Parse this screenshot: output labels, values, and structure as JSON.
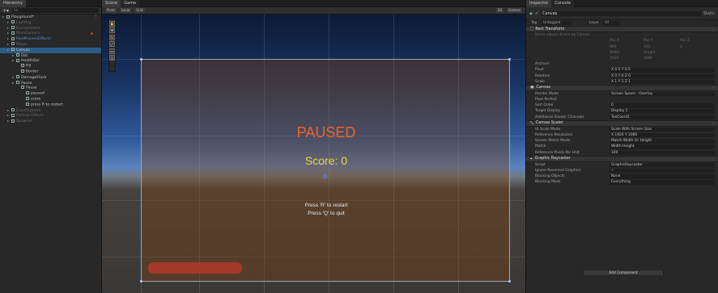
{
  "hierarchy": {
    "tab": "Hierarchy",
    "search_placeholder": "All",
    "items": [
      {
        "label": "Playground*",
        "depth": 0,
        "style": "scene"
      },
      {
        "label": "Lighting",
        "depth": 1,
        "style": "dim"
      },
      {
        "label": "Environment",
        "depth": 1,
        "style": "dim"
      },
      {
        "label": "MainCamera",
        "depth": 1,
        "style": "dim"
      },
      {
        "label": "PostProcessEffects",
        "depth": 1,
        "style": "blue"
      },
      {
        "label": "Player",
        "depth": 1,
        "style": "dim"
      },
      {
        "label": "Canvas",
        "depth": 1,
        "style": "sel"
      },
      {
        "label": "Dot",
        "depth": 2,
        "style": "norm"
      },
      {
        "label": "HealthBar",
        "depth": 2,
        "style": "norm"
      },
      {
        "label": "Fill",
        "depth": 3,
        "style": "norm"
      },
      {
        "label": "Border",
        "depth": 3,
        "style": "norm"
      },
      {
        "label": "DamageFlash",
        "depth": 2,
        "style": "norm"
      },
      {
        "label": "Pause",
        "depth": 2,
        "style": "norm"
      },
      {
        "label": "Pause",
        "depth": 3,
        "style": "norm"
      },
      {
        "label": "paused",
        "depth": 4,
        "style": "norm"
      },
      {
        "label": "score",
        "depth": 4,
        "style": "norm"
      },
      {
        "label": "press R to restart",
        "depth": 4,
        "style": "norm"
      },
      {
        "label": "EventSystem",
        "depth": 1,
        "style": "dim"
      },
      {
        "label": "Particle Effects",
        "depth": 1,
        "style": "dim"
      },
      {
        "label": "Spawner",
        "depth": 1,
        "style": "dim"
      }
    ]
  },
  "scene": {
    "tabs": [
      "Scene",
      "Game"
    ],
    "toolbar": [
      "Pivot",
      "Local",
      "Grid",
      "2D",
      "Gizmos"
    ],
    "game": {
      "paused": "PAUSED",
      "score": "Score: 0",
      "restart_hint": "Press 'R' to restart",
      "quit_hint": "Press 'Q' to quit"
    }
  },
  "inspector": {
    "tabs": [
      "Inspector",
      "Console"
    ],
    "object_name": "Canvas",
    "static_label": "Static",
    "tag_label": "Tag",
    "tag_value": "Untagged",
    "layer_label": "Layer",
    "layer_value": "UI",
    "rect_transform": {
      "title": "Rect Transform",
      "note": "Some values driven by Canvas.",
      "cols": [
        "Pos X",
        "Pos Y",
        "Pos Z"
      ],
      "pos": [
        "960",
        "540",
        "0"
      ],
      "size_cols": [
        "Width",
        "Height"
      ],
      "size": [
        "1920",
        "1080"
      ],
      "rows": [
        {
          "label": "Anchors",
          "value": ""
        },
        {
          "label": "Pivot",
          "value": "X 0.5    Y 0.5"
        },
        {
          "label": "Rotation",
          "value": "X 0    Y 0    Z 0"
        },
        {
          "label": "Scale",
          "value": "X 1    Y 1    Z 1"
        }
      ]
    },
    "canvas": {
      "title": "Canvas",
      "rows": [
        {
          "label": "Render Mode",
          "value": "Screen Space - Overlay"
        },
        {
          "label": "Pixel Perfect",
          "value": ""
        },
        {
          "label": "Sort Order",
          "value": "0"
        },
        {
          "label": "Target Display",
          "value": "Display 1"
        },
        {
          "label": "Additional Shader Channels",
          "value": "TexCoord1"
        }
      ]
    },
    "scaler": {
      "title": "Canvas Scaler",
      "rows": [
        {
          "label": "UI Scale Mode",
          "value": "Scale With Screen Size"
        },
        {
          "label": "Reference Resolution",
          "value": "X 1920    Y 1080"
        },
        {
          "label": "Screen Match Mode",
          "value": "Match Width Or Height"
        },
        {
          "label": "Match",
          "value": "Width                          Height"
        },
        {
          "label": "Reference Pixels Per Unit",
          "value": "100"
        }
      ]
    },
    "raycaster": {
      "title": "Graphic Raycaster",
      "rows": [
        {
          "label": "Script",
          "value": "GraphicRaycaster"
        },
        {
          "label": "Ignore Reversed Graphics",
          "value": "✓"
        },
        {
          "label": "Blocking Objects",
          "value": "None"
        },
        {
          "label": "Blocking Mask",
          "value": "Everything"
        }
      ]
    },
    "add_component": "Add Component"
  },
  "colors": {
    "paused": "#f06429",
    "score": "#f4d441",
    "selection": "#2c5d87"
  }
}
